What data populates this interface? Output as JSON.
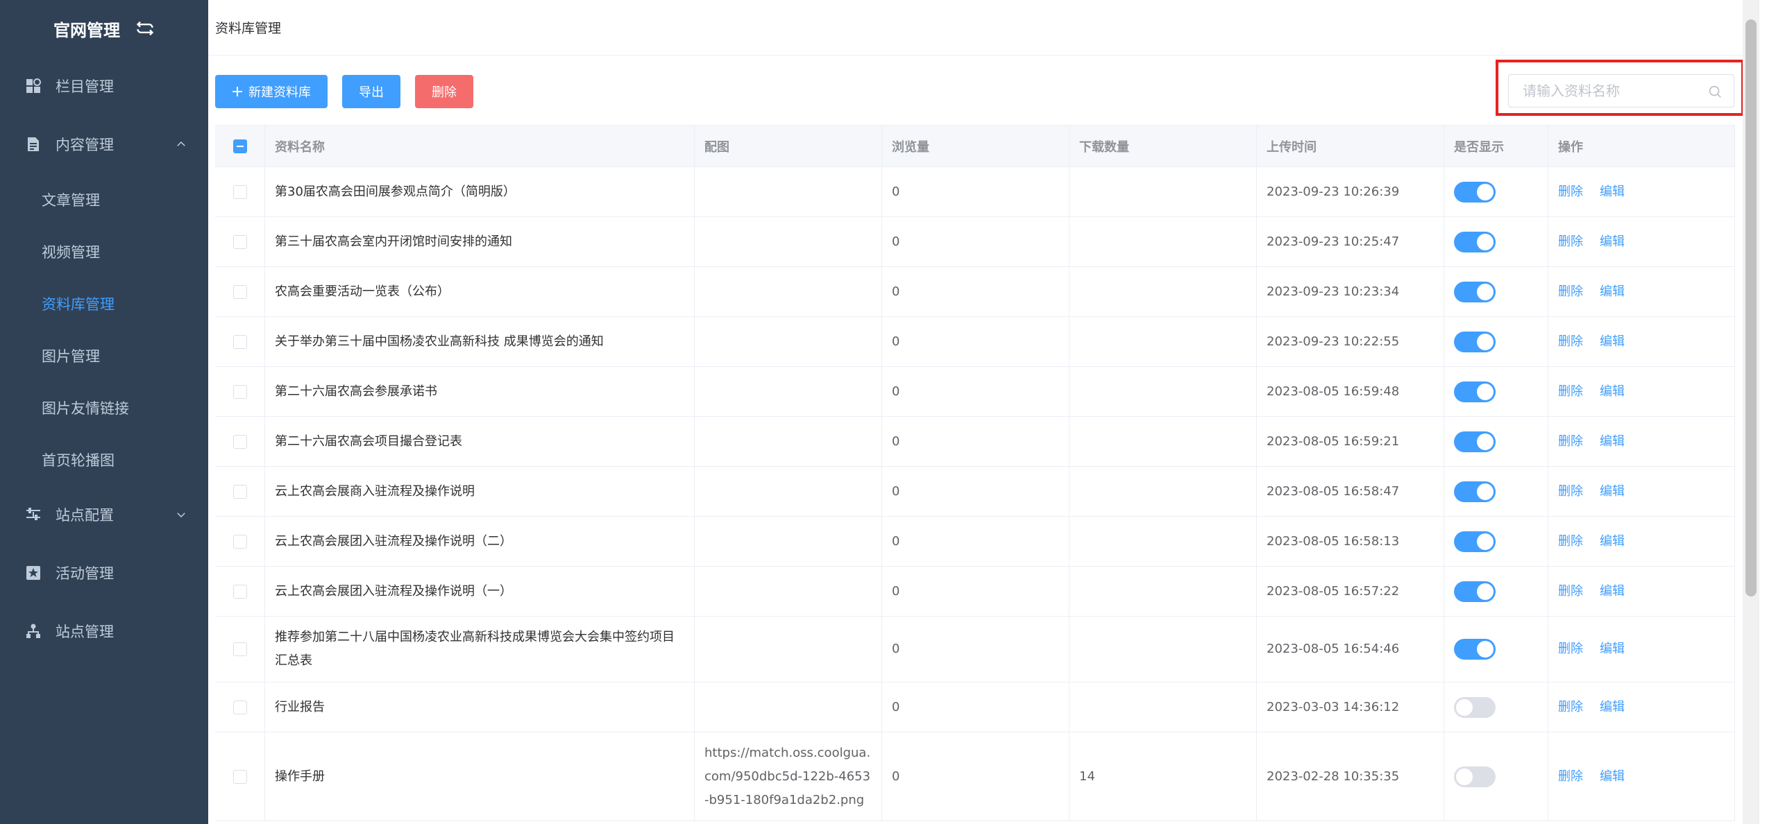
{
  "sidebar": {
    "title": "官网管理",
    "menu": [
      {
        "key": "column",
        "label": "栏目管理",
        "icon": "grid-icon"
      },
      {
        "key": "content",
        "label": "内容管理",
        "icon": "document-icon",
        "expanded": true
      },
      {
        "key": "site-config",
        "label": "站点配置",
        "icon": "settings-sliders-icon",
        "expanded": false
      },
      {
        "key": "activity",
        "label": "活动管理",
        "icon": "star-box-icon"
      },
      {
        "key": "site",
        "label": "站点管理",
        "icon": "sitemap-icon"
      }
    ],
    "content_sub": [
      {
        "label": "文章管理",
        "active": false
      },
      {
        "label": "视频管理",
        "active": false
      },
      {
        "label": "资料库管理",
        "active": true
      },
      {
        "label": "图片管理",
        "active": false
      },
      {
        "label": "图片友情链接",
        "active": false
      },
      {
        "label": "首页轮播图",
        "active": false
      }
    ]
  },
  "breadcrumb": "资料库管理",
  "toolbar": {
    "new_label": "新建资料库",
    "export_label": "导出",
    "delete_label": "删除"
  },
  "search": {
    "placeholder": "请输入资料名称",
    "value": ""
  },
  "table": {
    "headers": {
      "name": "资料名称",
      "pic": "配图",
      "views": "浏览量",
      "downloads": "下载数量",
      "time": "上传时间",
      "show": "是否显示",
      "ops": "操作"
    },
    "action_delete": "删除",
    "action_edit": "编辑",
    "rows": [
      {
        "name": "第30届农高会田间展参观点简介（简明版）",
        "pic": "",
        "views": "0",
        "downloads": "",
        "time": "2023-09-23 10:26:39",
        "show": true
      },
      {
        "name": "第三十届农高会室内开闭馆时间安排的通知",
        "pic": "",
        "views": "0",
        "downloads": "",
        "time": "2023-09-23 10:25:47",
        "show": true
      },
      {
        "name": "农高会重要活动一览表（公布）",
        "pic": "",
        "views": "0",
        "downloads": "",
        "time": "2023-09-23 10:23:34",
        "show": true
      },
      {
        "name": "关于举办第三十届中国杨凌农业高新科技 成果博览会的通知",
        "pic": "",
        "views": "0",
        "downloads": "",
        "time": "2023-09-23 10:22:55",
        "show": true
      },
      {
        "name": "第二十六届农高会参展承诺书",
        "pic": "",
        "views": "0",
        "downloads": "",
        "time": "2023-08-05 16:59:48",
        "show": true
      },
      {
        "name": "第二十六届农高会项目撮合登记表",
        "pic": "",
        "views": "0",
        "downloads": "",
        "time": "2023-08-05 16:59:21",
        "show": true
      },
      {
        "name": "云上农高会展商入驻流程及操作说明",
        "pic": "",
        "views": "0",
        "downloads": "",
        "time": "2023-08-05 16:58:47",
        "show": true
      },
      {
        "name": "云上农高会展团入驻流程及操作说明（二）",
        "pic": "",
        "views": "0",
        "downloads": "",
        "time": "2023-08-05 16:58:13",
        "show": true
      },
      {
        "name": "云上农高会展团入驻流程及操作说明（一）",
        "pic": "",
        "views": "0",
        "downloads": "",
        "time": "2023-08-05 16:57:22",
        "show": true
      },
      {
        "name": "推荐参加第二十八届中国杨凌农业高新科技成果博览会大会集中签约项目汇总表",
        "pic": "",
        "views": "0",
        "downloads": "",
        "time": "2023-08-05 16:54:46",
        "show": true
      },
      {
        "name": "行业报告",
        "pic": "",
        "views": "0",
        "downloads": "",
        "time": "2023-03-03 14:36:12",
        "show": false
      },
      {
        "name": "操作手册",
        "pic": "https://match.oss.coolgua.com/950dbc5d-122b-4653-b951-180f9a1da2b2.png",
        "views": "0",
        "downloads": "14",
        "time": "2023-02-28 10:35:35",
        "show": false
      }
    ]
  },
  "colors": {
    "sidebar_bg": "#304156",
    "primary": "#409eff",
    "danger": "#f56c6c",
    "highlight": "#e6231f"
  }
}
